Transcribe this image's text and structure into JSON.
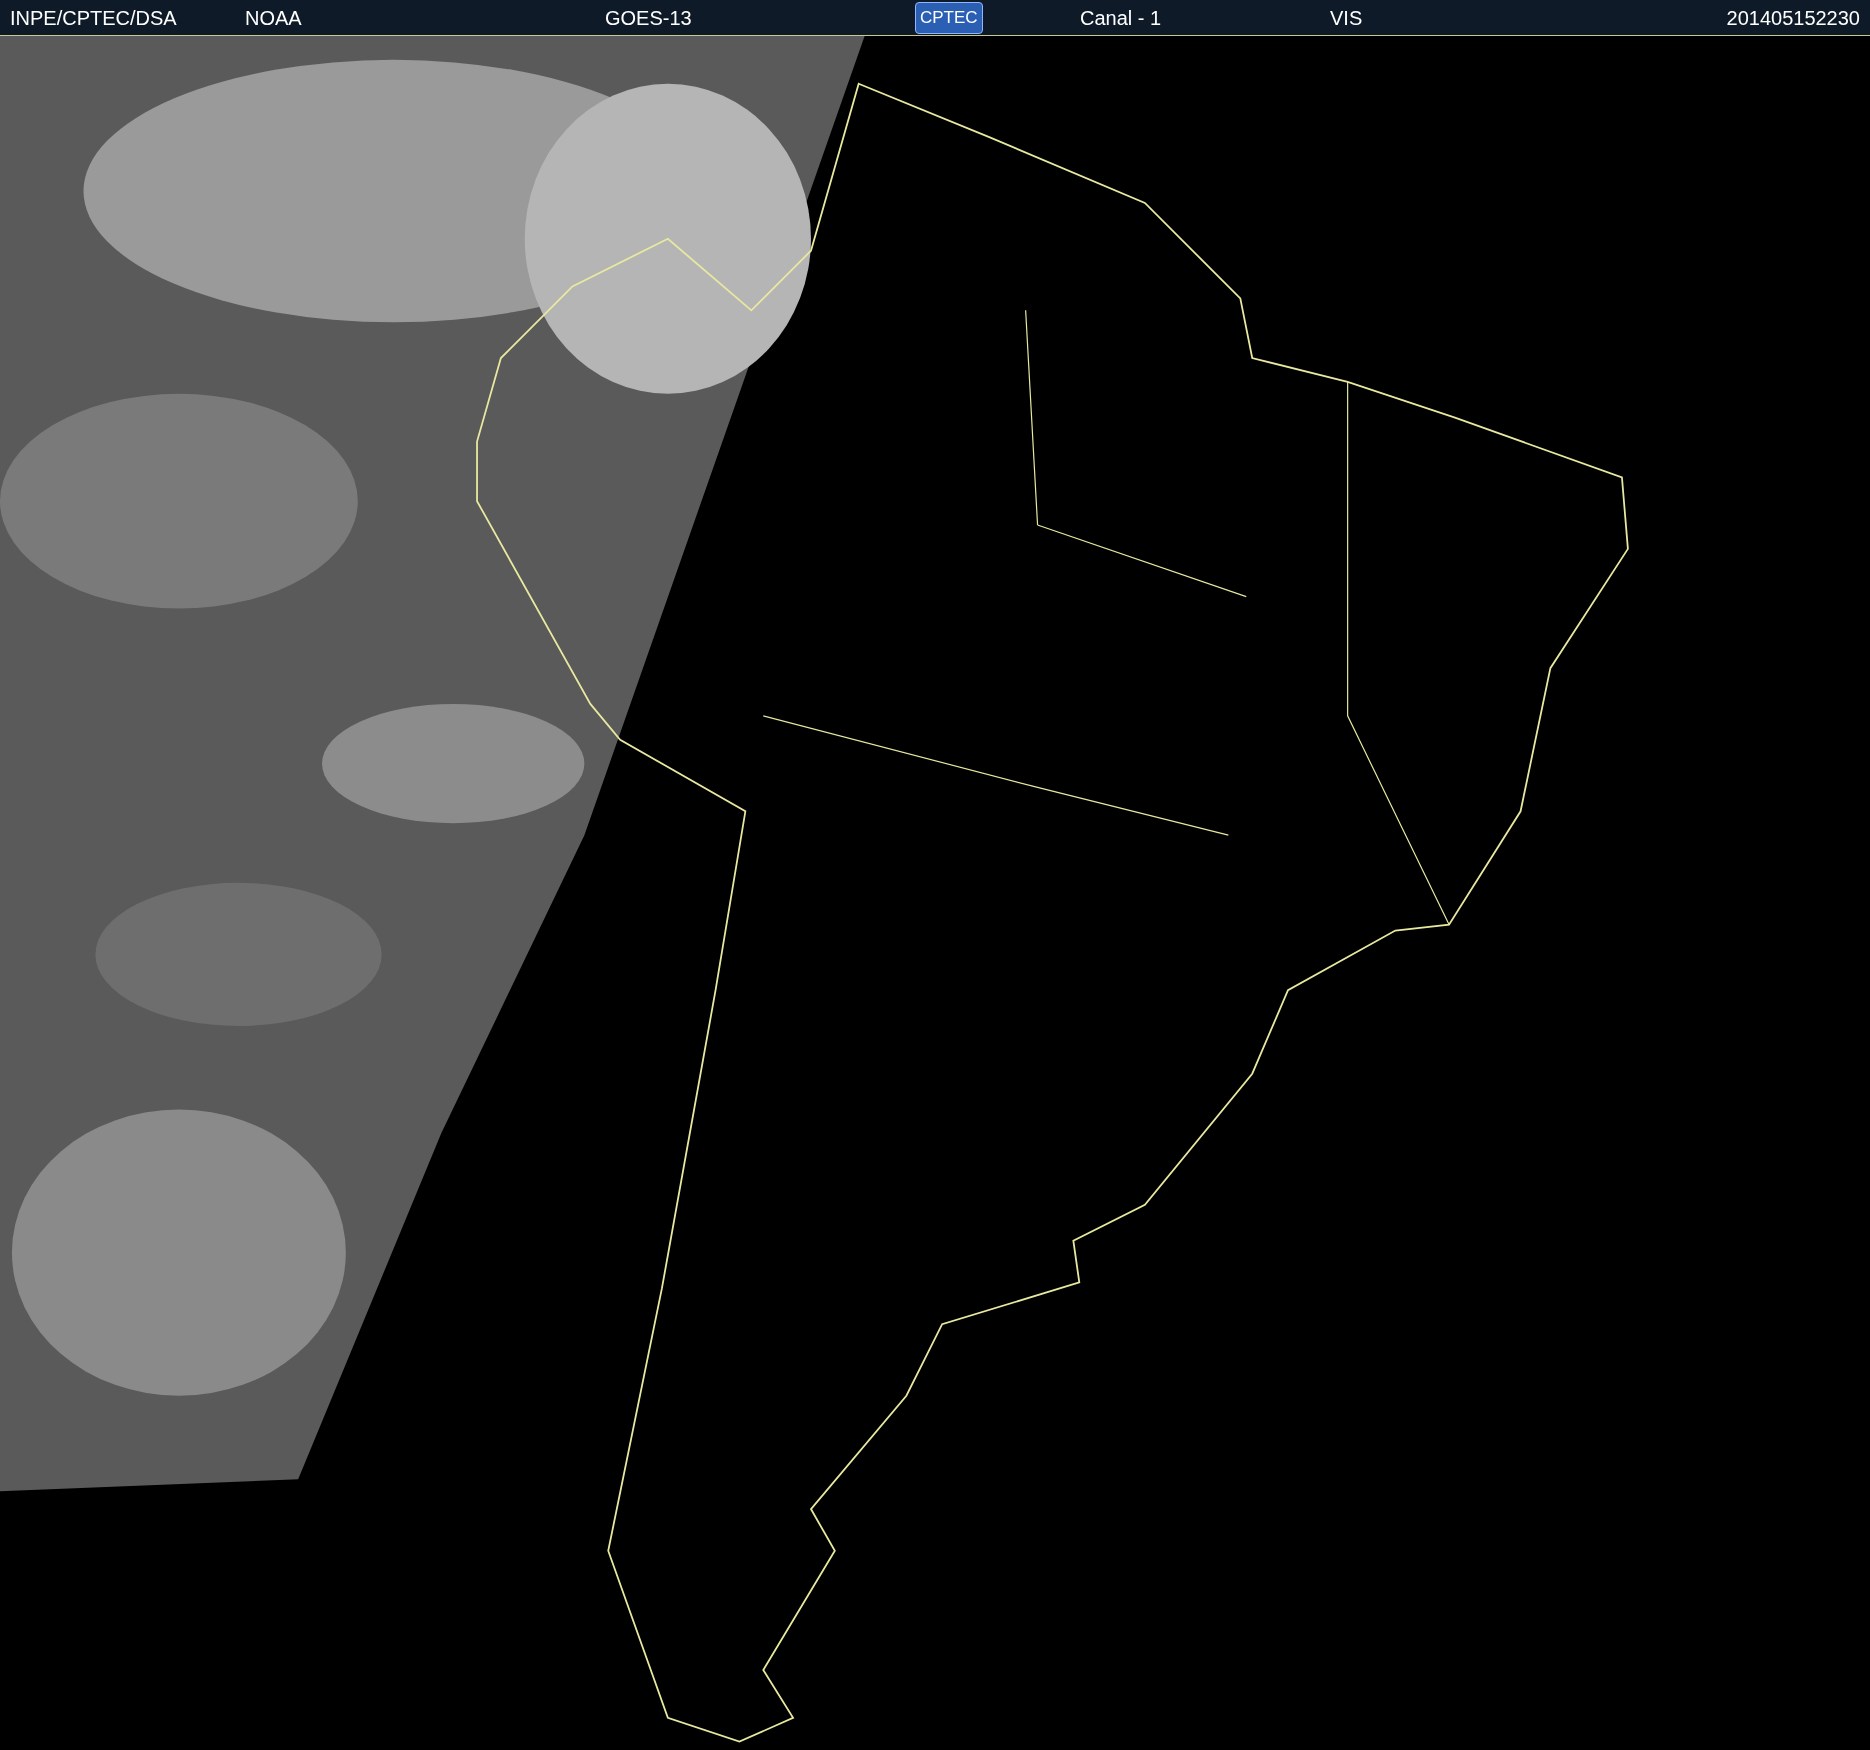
{
  "header": {
    "items": [
      {
        "kind": "text",
        "text": "INPE/CPTEC/DSA"
      },
      {
        "kind": "text",
        "text": "NOAA"
      },
      {
        "kind": "text",
        "text": "GOES-13"
      },
      {
        "kind": "logo",
        "text": "CPTEC"
      },
      {
        "kind": "text",
        "text": "Canal - 1"
      },
      {
        "kind": "text",
        "text": "VIS"
      },
      {
        "kind": "text",
        "text": "201405152230"
      }
    ]
  }
}
